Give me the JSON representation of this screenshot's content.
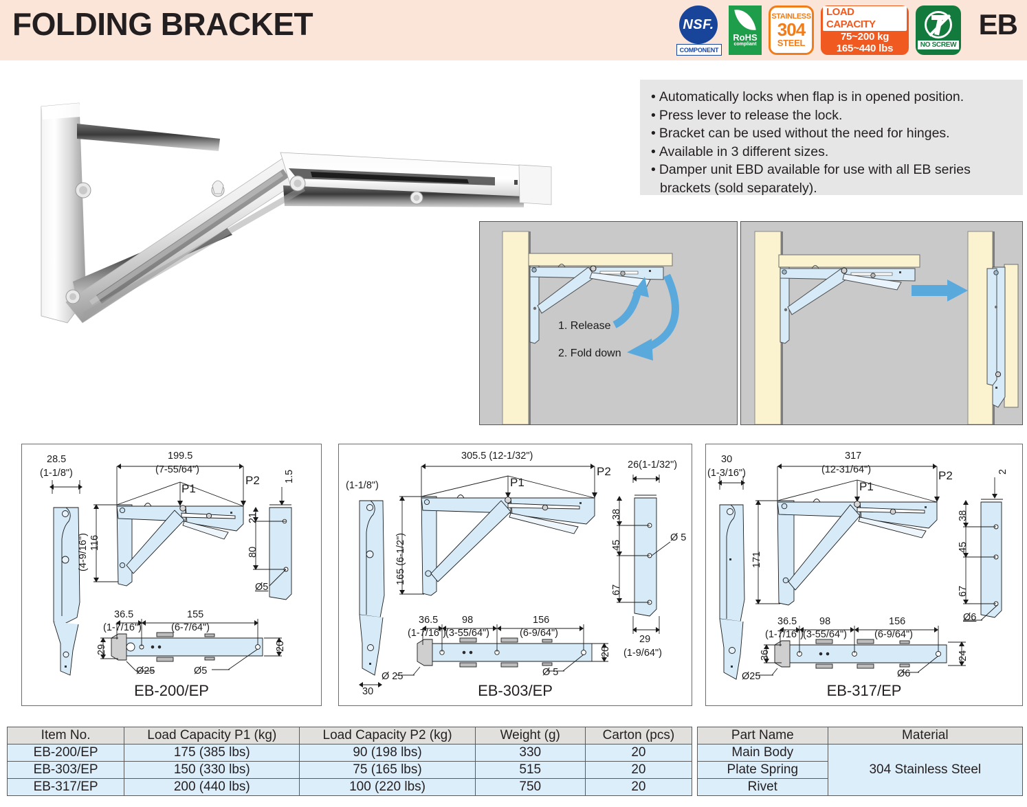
{
  "header": {
    "title": "FOLDING BRACKET",
    "series_code": "EB",
    "background_color": "#fbe4d8",
    "badges": [
      {
        "name": "nsf",
        "main": "NSF.",
        "sub": "COMPONENT",
        "color": "#18449a"
      },
      {
        "name": "rohs",
        "main": "RoHS",
        "sub": "compliant",
        "color": "#1e9e4a"
      },
      {
        "name": "stainless-304",
        "line1": "STAINLESS",
        "line2": "304",
        "line3": "STEEL",
        "color": "#f07d1a"
      },
      {
        "name": "load-capacity",
        "title": "LOAD CAPACITY",
        "line1": "75~200 kg",
        "line2": "165~440 lbs",
        "color": "#f0591f"
      },
      {
        "name": "no-screw",
        "label": "NO SCREW",
        "color": "#127a3d"
      }
    ]
  },
  "features": {
    "items": [
      "Automatically locks when flap is in opened position.",
      "Press lever to release the lock.",
      "Bracket can be used without the need for hinges.",
      "Available in 3 different sizes.",
      "Damper unit EBD available for use with all EB series brackets (sold separately)."
    ]
  },
  "howto": {
    "step1": "1. Release",
    "step2": "2. Fold down"
  },
  "drawings": [
    {
      "title": "EB-200/EP",
      "labels": {
        "width_mm": "199.5",
        "width_in": "(7-55/64\")",
        "p1": "P1",
        "p2": "P2",
        "side_thickness_mm": "28.5",
        "side_thickness_in": "(1-1/8\")",
        "height_mm": "116",
        "height_in": "(4-9/16\")",
        "plate_top": "1.5",
        "hole_a": "21",
        "hole_b": "80",
        "hole_dia_side": "Ø5",
        "top_a_mm": "36.5",
        "top_a_in": "(1-7/16\")",
        "top_b_mm": "155",
        "top_b_in": "(6-7/64\")",
        "top_depth": "20",
        "top_left_h": "29",
        "dia_25": "Ø25",
        "dia_5": "Ø5"
      }
    },
    {
      "title": "EB-303/EP",
      "labels": {
        "width": "305.5 (12-1/32\")",
        "p1": "P1",
        "p2": "P2",
        "side_thickness_in": "(1-1/8\")",
        "height": "165 (6-1/2\")",
        "plate_width": "26(1-1/32\")",
        "hole_a": "38",
        "hole_b": "45",
        "hole_c": "67",
        "hole_dia_side": "Ø 5",
        "plate_bottom_mm": "29",
        "plate_bottom_in": "(1-9/64\")",
        "side_bottom": "30",
        "top_a_mm": "36.5",
        "top_a_in": "(1-7/16\")",
        "top_b_mm": "98",
        "top_b_in": "(3-55/64\")",
        "top_c_mm": "156",
        "top_c_in": "(6-9/64\")",
        "top_depth": "20",
        "dia_25": "Ø 25",
        "dia_5": "Ø 5"
      }
    },
    {
      "title": "EB-317/EP",
      "labels": {
        "width_mm": "317",
        "width_in": "(12-31/64\")",
        "p1": "P1",
        "p2": "P2",
        "side_thickness_mm": "30",
        "side_thickness_in": "(1-3/16\")",
        "height_mm": "171",
        "plate_top": "2",
        "hole_a": "38",
        "hole_b": "45",
        "hole_c": "67",
        "hole_dia_side": "Ø6",
        "top_a_mm": "36.5",
        "top_a_in": "(1-7/16\")",
        "top_b_mm": "98",
        "top_b_in": "(3-55/64\")",
        "top_c_mm": "156",
        "top_c_in": "(6-9/64\")",
        "top_depth": "24",
        "top_left_h": "36",
        "dia_25": "Ø25",
        "dia_6": "Ø6"
      }
    }
  ],
  "spec_table": {
    "headers": [
      "Item No.",
      "Load Capacity P1 (kg)",
      "Load Capacity P2 (kg)",
      "Weight (g)",
      "Carton (pcs)"
    ],
    "rows": [
      [
        "EB-200/EP",
        "175 (385 lbs)",
        "90 (198 lbs)",
        "330",
        "20"
      ],
      [
        "EB-303/EP",
        "150 (330 lbs)",
        "75 (165 lbs)",
        "515",
        "20"
      ],
      [
        "EB-317/EP",
        "200 (440 lbs)",
        "100 (220 lbs)",
        "750",
        "20"
      ]
    ]
  },
  "material_table": {
    "headers": [
      "Part Name",
      "Material"
    ],
    "parts": [
      "Main Body",
      "Plate Spring",
      "Rivet"
    ],
    "material": "304 Stainless Steel"
  }
}
